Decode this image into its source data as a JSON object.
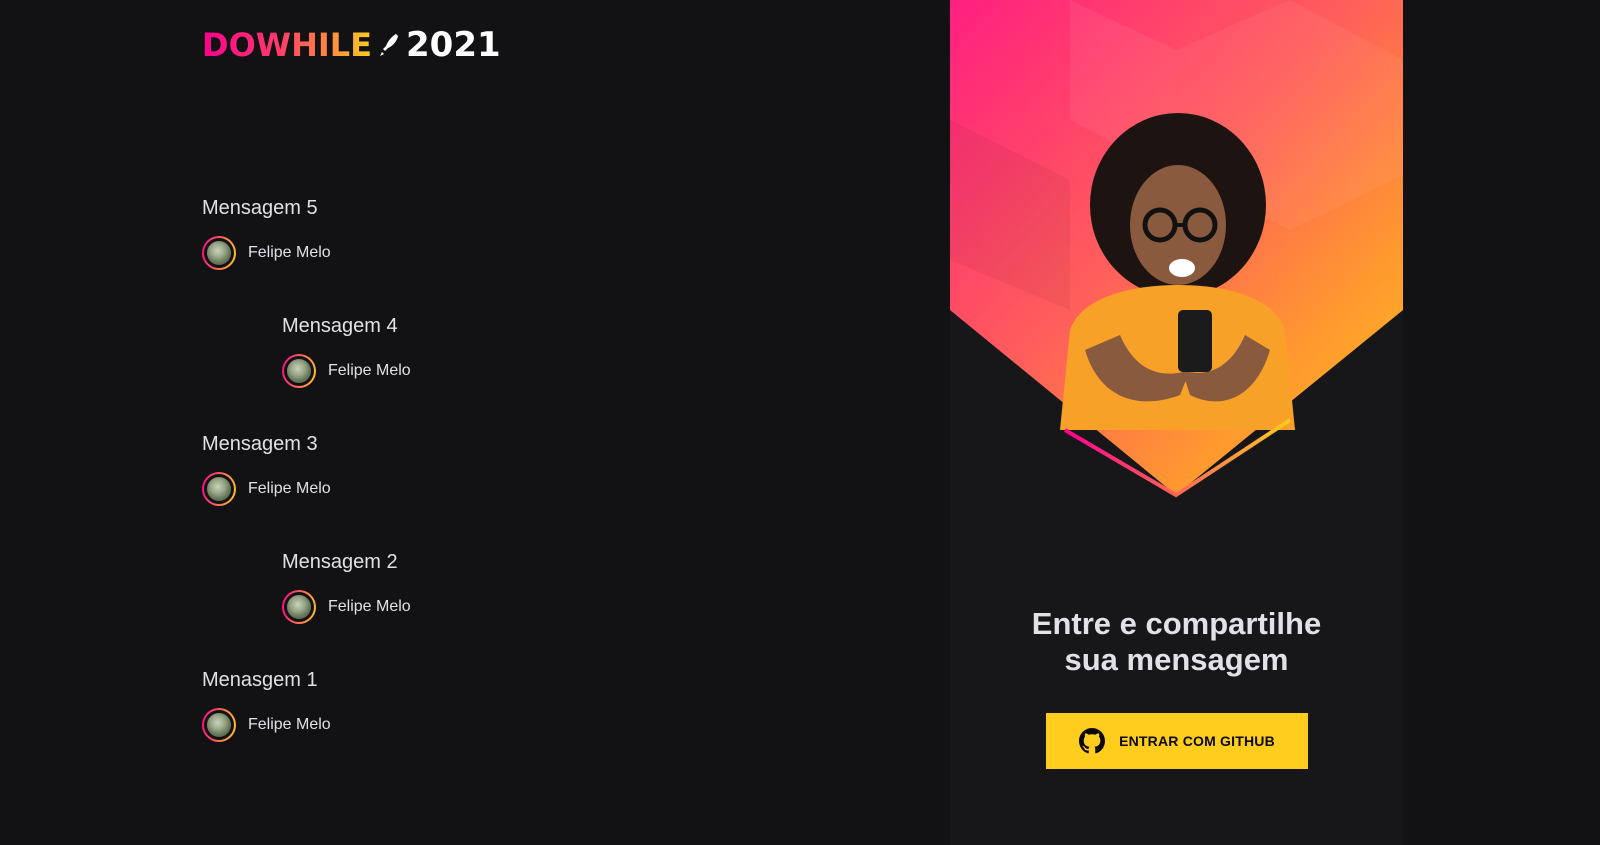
{
  "logo": {
    "brand": "DOWHILE",
    "year": "2021"
  },
  "messages": [
    {
      "text": "Mensagem 5",
      "user": "Felipe Melo",
      "indent": false
    },
    {
      "text": "Mensagem 4",
      "user": "Felipe Melo",
      "indent": true
    },
    {
      "text": "Mensagem 3",
      "user": "Felipe Melo",
      "indent": false
    },
    {
      "text": "Mensagem 2",
      "user": "Felipe Melo",
      "indent": true
    },
    {
      "text": "Menasgem 1",
      "user": "Felipe Melo",
      "indent": false
    }
  ],
  "login": {
    "title_line1": "Entre e compartilhe",
    "title_line2": "sua mensagem",
    "button_label": "ENTRAR COM GITHUB"
  },
  "colors": {
    "background": "#121214",
    "panel": "#17171a",
    "accent_pink": "#ff008e",
    "accent_yellow": "#ffcd1e",
    "text": "#e1e1e6"
  },
  "icons": {
    "github": "github-icon",
    "rocket": "rocket-icon"
  }
}
